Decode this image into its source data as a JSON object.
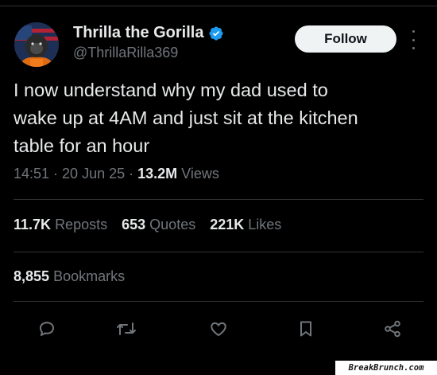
{
  "tweet": {
    "display_name": "Thrilla the Gorilla",
    "verified_icon": "verified-badge-icon",
    "handle": "@ThrillaRilla369",
    "follow_label": "Follow",
    "text": "I now understand  why my dad used to\nwake up at 4AM and just sit at the kitchen\ntable for an hour",
    "time": "14:51",
    "date": "20 Jun 25",
    "separator": " · ",
    "views_count": "13.2M",
    "views_label": "Views"
  },
  "stats": {
    "reposts_count": "11.7K",
    "reposts_label": "Reposts",
    "quotes_count": "653",
    "quotes_label": "Quotes",
    "likes_count": "221K",
    "likes_label": "Likes",
    "bookmarks_count": "8,855",
    "bookmarks_label": "Bookmarks"
  },
  "actions": [
    "reply-icon",
    "repost-icon",
    "like-icon",
    "bookmark-icon",
    "share-icon"
  ],
  "watermark": "BreakBrunch.com",
  "colors": {
    "background": "#000000",
    "primary_text": "#e7e9ea",
    "secondary_text": "#71767b",
    "divider": "#2f3336",
    "verified": "#1d9bf0",
    "follow_bg": "#eff3f4"
  }
}
